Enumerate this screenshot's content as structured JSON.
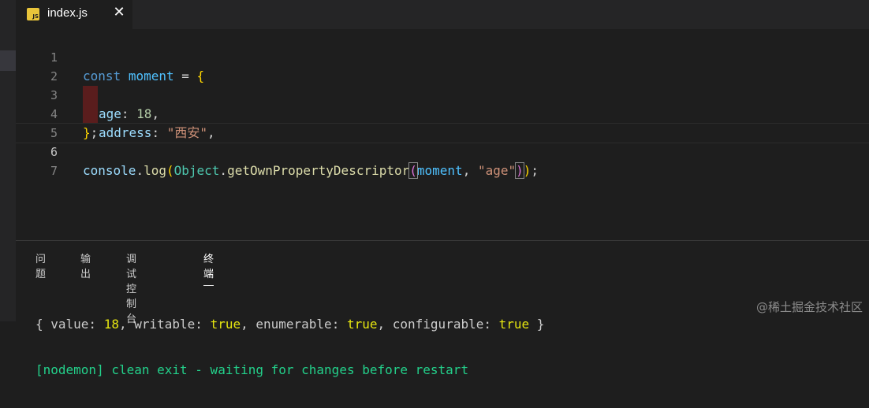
{
  "tab": {
    "filename": "index.js",
    "icon_label": "JS",
    "close_glyph": "✕"
  },
  "editor": {
    "line_numbers": [
      "1",
      "2",
      "3",
      "4",
      "5",
      "6",
      "7"
    ],
    "l1": {
      "kw": "const",
      "name": "moment",
      "op": " = ",
      "brace": "{"
    },
    "l2": {
      "key": "age",
      "colon": ": ",
      "value": "18",
      "comma": ","
    },
    "l3": {
      "key": "address",
      "colon": ": ",
      "value": "\"西安\"",
      "comma": ","
    },
    "l4": {
      "brace": "}",
      "semi": ";"
    },
    "l6": {
      "obj": "console",
      "dot1": ".",
      "fn": "log",
      "p1": "(",
      "cls": "Object",
      "dot2": ".",
      "method": "getOwnPropertyDescriptor",
      "p2": "(",
      "arg1": "moment",
      "sep": ", ",
      "arg2": "\"age\"",
      "p3": ")",
      "p4": ")",
      "semi": ";"
    }
  },
  "panel": {
    "tabs": [
      "问题",
      "输出",
      "调试控制台",
      "终端"
    ],
    "active_tab": "终端",
    "output_line": {
      "open": "{ ",
      "k1": "value: ",
      "v1": "18",
      "c1": ", ",
      "k2": "writable: ",
      "v2": "true",
      "c2": ", ",
      "k3": "enumerable: ",
      "v3": "true",
      "c3": ", ",
      "k4": "configurable: ",
      "v4": "true",
      "close": " }"
    },
    "nodemon_line": "[nodemon] clean exit - waiting for changes before restart"
  },
  "watermark": "@稀土掘金技术社区",
  "colors": {
    "background": "#1e1e1e",
    "keyword": "#569cd6",
    "string": "#ce9178",
    "number": "#b5cea8",
    "terminal_green": "#23d18b",
    "terminal_yellow": "#e5e510"
  }
}
